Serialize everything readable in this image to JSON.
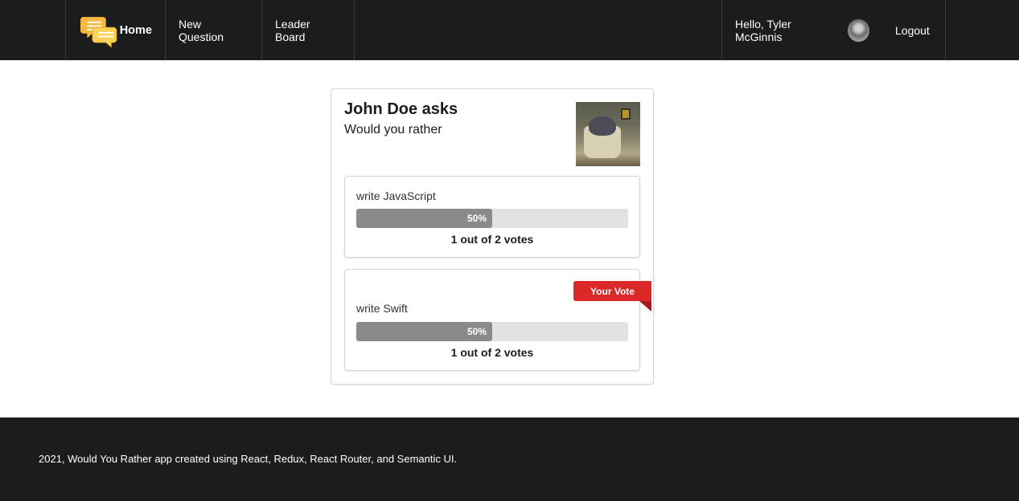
{
  "nav": {
    "home_label": "Home",
    "new_question_label": "New Question",
    "leader_board_label": "Leader Board",
    "greeting": "Hello, Tyler McGinnis",
    "logout_label": "Logout",
    "logo_icon": "chat-bubbles-icon"
  },
  "question": {
    "asker": "John Doe asks",
    "subtitle": "Would you rather",
    "options": [
      {
        "text": "write JavaScript",
        "percent_label": "50%",
        "percent": 50,
        "votes_label": "1 out of 2 votes",
        "is_user_vote": false
      },
      {
        "text": "write Swift",
        "percent_label": "50%",
        "percent": 50,
        "votes_label": "1 out of 2 votes",
        "is_user_vote": true
      }
    ],
    "your_vote_label": "Your Vote"
  },
  "footer": {
    "text": "2021, Would You Rather app created using React, Redux, React Router, and Semantic UI."
  },
  "colors": {
    "nav_bg": "#1b1c1d",
    "ribbon": "#db2828",
    "bar_fill": "#8a8a8a",
    "bar_track": "#e2e2e2"
  }
}
